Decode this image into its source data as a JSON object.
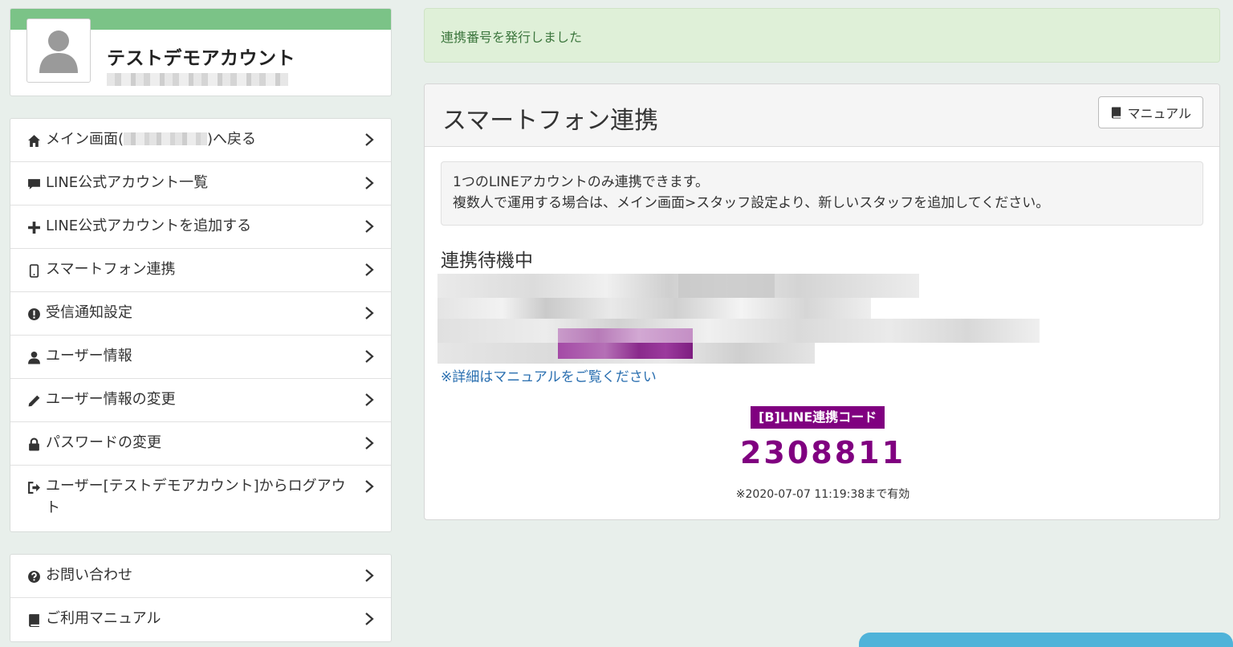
{
  "profile": {
    "name": "テストデモアカウント",
    "avatar_icon": "user-silhouette-icon"
  },
  "menu_main": [
    {
      "icon": "home-icon",
      "label_prefix": "メイン画面(",
      "label_suffix": ")へ戻る"
    },
    {
      "icon": "comment-icon",
      "label": "LINE公式アカウント一覧"
    },
    {
      "icon": "plus-icon",
      "label": "LINE公式アカウントを追加する"
    },
    {
      "icon": "mobile-icon",
      "label": "スマートフォン連携"
    },
    {
      "icon": "exclamation-circle-icon",
      "label": "受信通知設定"
    },
    {
      "icon": "user-icon",
      "label": "ユーザー情報"
    },
    {
      "icon": "pencil-icon",
      "label": "ユーザー情報の変更"
    },
    {
      "icon": "lock-icon",
      "label": "パスワードの変更"
    },
    {
      "icon": "sign-out-icon",
      "label": "ユーザー[テストデモアカウント]からログアウト"
    }
  ],
  "menu_support": [
    {
      "icon": "question-circle-icon",
      "label": "お問い合わせ"
    },
    {
      "icon": "book-icon",
      "label": "ご利用マニュアル"
    }
  ],
  "alert": {
    "message": "連携番号を発行しました"
  },
  "panel": {
    "title": "スマートフォン連携",
    "manual_button": "マニュアル",
    "info_line1": "1つのLINEアカウントのみ連携できます。",
    "info_line2": "複数人で運用する場合は、メイン画面>スタッフ設定より、新しいスタッフを追加してください。",
    "status": "連携待機中",
    "manual_link": "※詳細はマニュアルをご覧ください",
    "code_label": "[B]LINE連携コード",
    "code_value": "2308811",
    "code_expire": "※2020-07-07 11:19:38まで有効"
  },
  "colors": {
    "accent_green": "#7bc387",
    "alert_bg": "#dff0d8",
    "alert_text": "#3c763d",
    "code_purple": "#800080",
    "link_blue": "#2a6fb0",
    "chat_blue": "#4fb3d9"
  }
}
